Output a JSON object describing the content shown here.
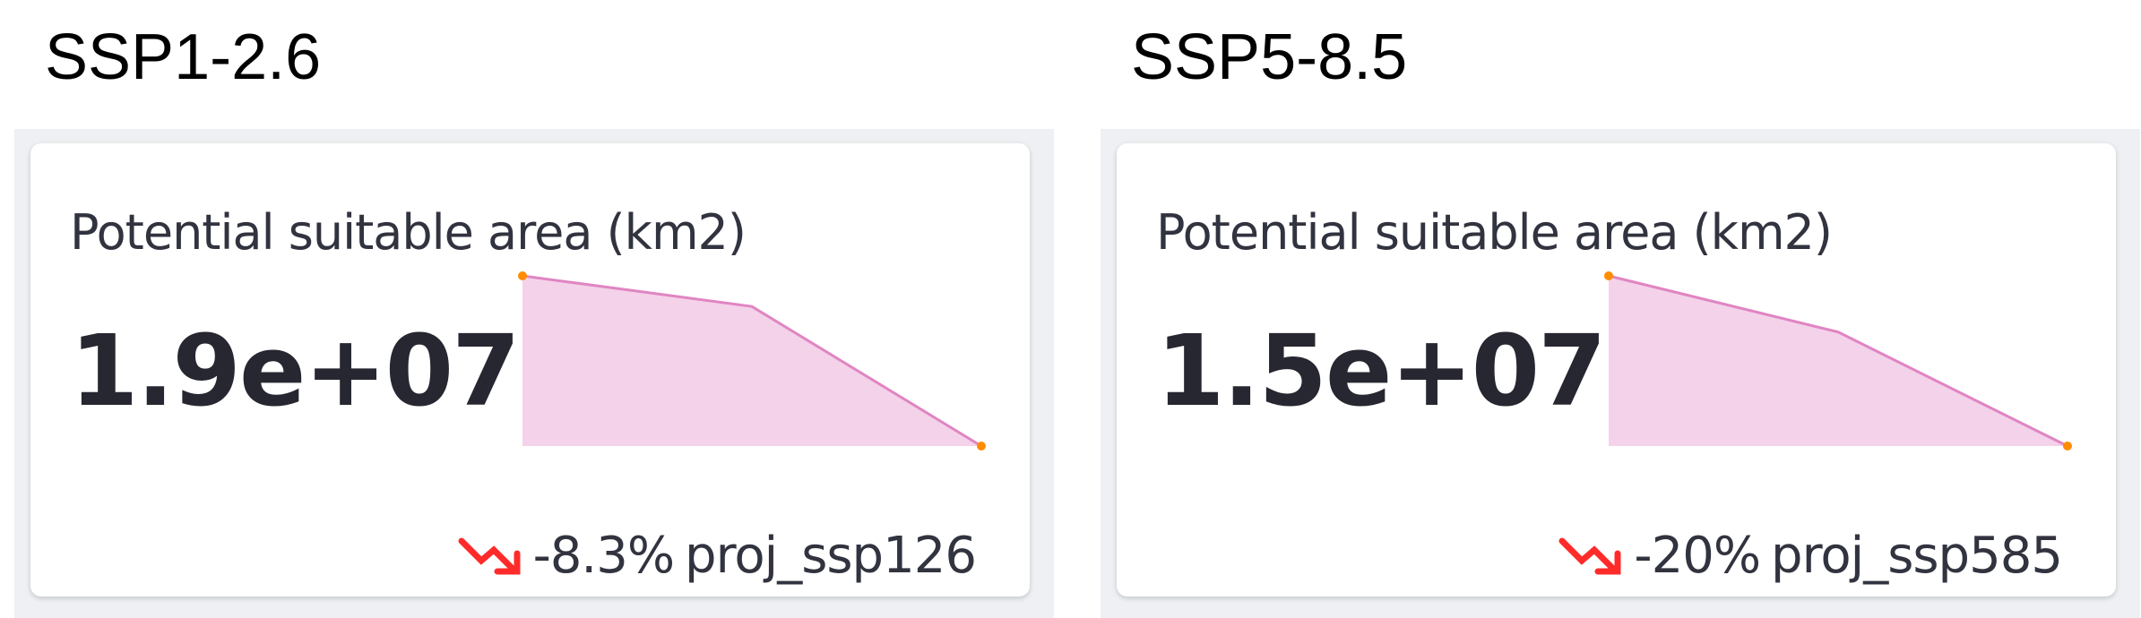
{
  "colors": {
    "sparkline_fill": "#f4d2ea",
    "sparkline_line": "#e085c2",
    "sparkline_point": "#ff8c00",
    "delta_negative": "#ff2b2b"
  },
  "panels": [
    {
      "title": "SSP1-2.6",
      "metric": {
        "label": "Potential suitable area (km2)",
        "value": "1.9e+07",
        "delta": "-8.3%",
        "delta_label": "proj_ssp126",
        "delta_icon": "trend-down-icon",
        "trend": [
          1.0,
          0.82,
          0.0
        ]
      }
    },
    {
      "title": "SSP5-8.5",
      "metric": {
        "label": "Potential suitable area (km2)",
        "value": "1.5e+07",
        "delta": "-20%",
        "delta_label": "proj_ssp585",
        "delta_icon": "trend-down-icon",
        "trend": [
          1.0,
          0.67,
          0.0
        ]
      }
    }
  ]
}
